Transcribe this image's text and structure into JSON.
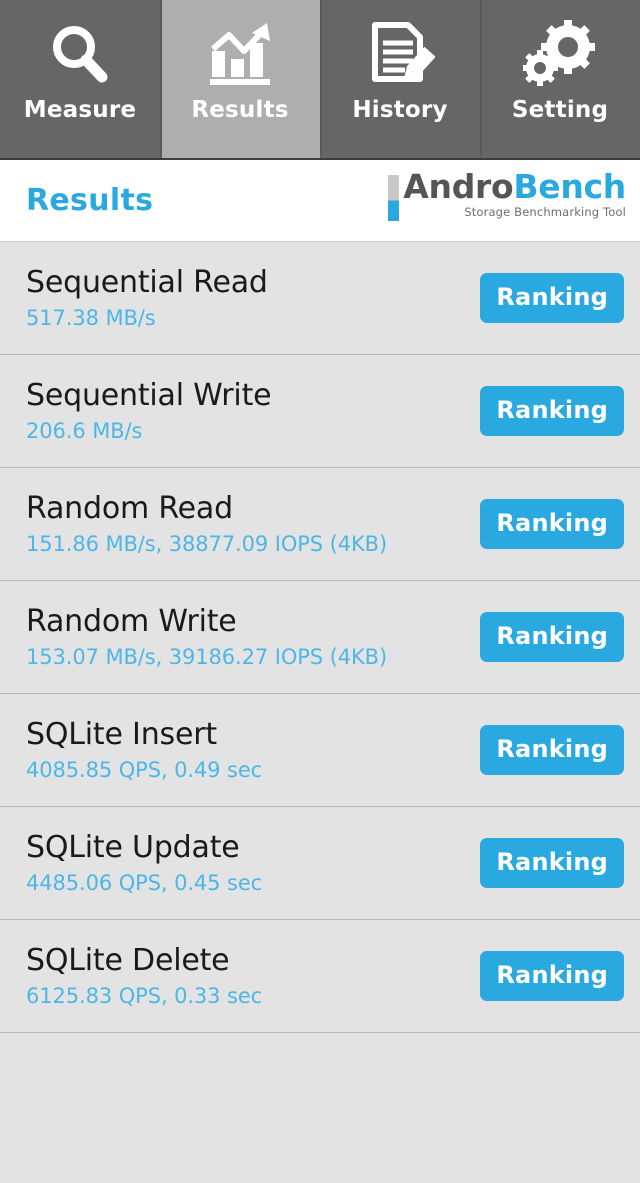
{
  "tabs": [
    {
      "label": "Measure",
      "icon": "magnifier-icon",
      "active": false
    },
    {
      "label": "Results",
      "icon": "bar-chart-icon",
      "active": true
    },
    {
      "label": "History",
      "icon": "document-pencil-icon",
      "active": false
    },
    {
      "label": "Setting",
      "icon": "gears-icon",
      "active": false
    }
  ],
  "header": {
    "title": "Results",
    "brand_first": "Andro",
    "brand_second": "Bench",
    "brand_tagline": "Storage Benchmarking Tool"
  },
  "colors": {
    "accent_blue": "#2aa9e0",
    "value_blue": "#4cb7e6",
    "tabbar_gray": "#666666",
    "tab_active_gray": "#aeaeae",
    "page_gray": "#e3e3e3",
    "divider_gray": "#b8b8b8"
  },
  "results": {
    "ranking_label": "Ranking",
    "rows": [
      {
        "name": "Sequential Read",
        "value": "517.38 MB/s"
      },
      {
        "name": "Sequential Write",
        "value": "206.6 MB/s"
      },
      {
        "name": "Random Read",
        "value": "151.86 MB/s, 38877.09 IOPS (4KB)"
      },
      {
        "name": "Random Write",
        "value": "153.07 MB/s, 39186.27 IOPS (4KB)"
      },
      {
        "name": "SQLite Insert",
        "value": "4085.85 QPS, 0.49 sec"
      },
      {
        "name": "SQLite Update",
        "value": "4485.06 QPS, 0.45 sec"
      },
      {
        "name": "SQLite Delete",
        "value": "6125.83 QPS, 0.33 sec"
      }
    ]
  }
}
